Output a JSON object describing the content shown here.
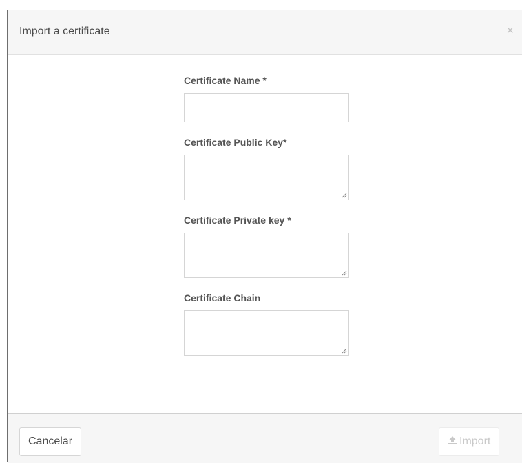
{
  "dialog": {
    "title": "Import a certificate",
    "close_symbol": "×",
    "close_icon": "close-icon"
  },
  "form": {
    "name_label": "Certificate Name *",
    "name_value": "",
    "public_key_label": "Certificate Public Key*",
    "public_key_value": "",
    "private_key_label": "Certificate Private key *",
    "private_key_value": "",
    "chain_label": "Certificate Chain",
    "chain_value": ""
  },
  "footer": {
    "cancel_label": "Cancelar",
    "import_label": "Import",
    "import_icon": "upload-icon",
    "import_disabled": true
  },
  "colors": {
    "header_bg": "#f6f6f6",
    "label_text": "#555555",
    "disabled_text": "#c9c9c9"
  }
}
